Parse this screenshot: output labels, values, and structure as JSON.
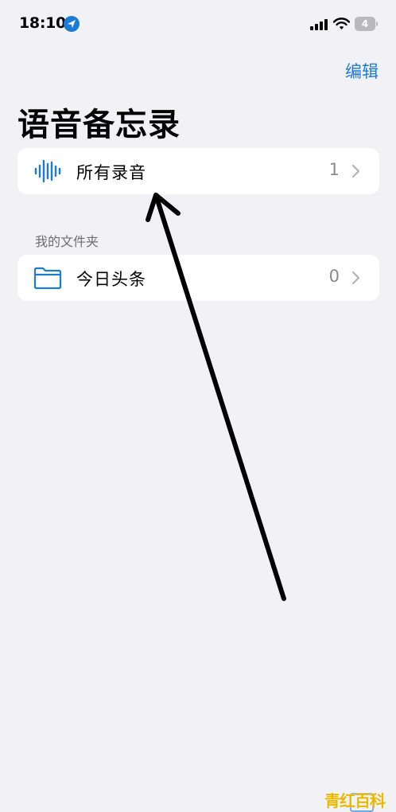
{
  "status_bar": {
    "time": "18:10",
    "battery": "4"
  },
  "nav": {
    "edit_label": "编辑"
  },
  "page": {
    "title": "语音备忘录"
  },
  "all_recordings": {
    "label": "所有录音",
    "count": "1"
  },
  "folders": {
    "header": "我的文件夹",
    "items": [
      {
        "label": "今日头条",
        "count": "0"
      }
    ]
  },
  "watermark": {
    "text": "青红百科"
  },
  "colors": {
    "accent": "#1c7cd5",
    "background": "#f2f1f6",
    "card": "#ffffff",
    "secondary_text": "#8a8a8e"
  },
  "icons": {
    "location": "location-arrow-icon",
    "signal": "cellular-signal-icon",
    "wifi": "wifi-icon",
    "battery": "battery-charging-icon",
    "waveform": "waveform-icon",
    "folder": "folder-icon",
    "chevron": "chevron-right-icon"
  }
}
